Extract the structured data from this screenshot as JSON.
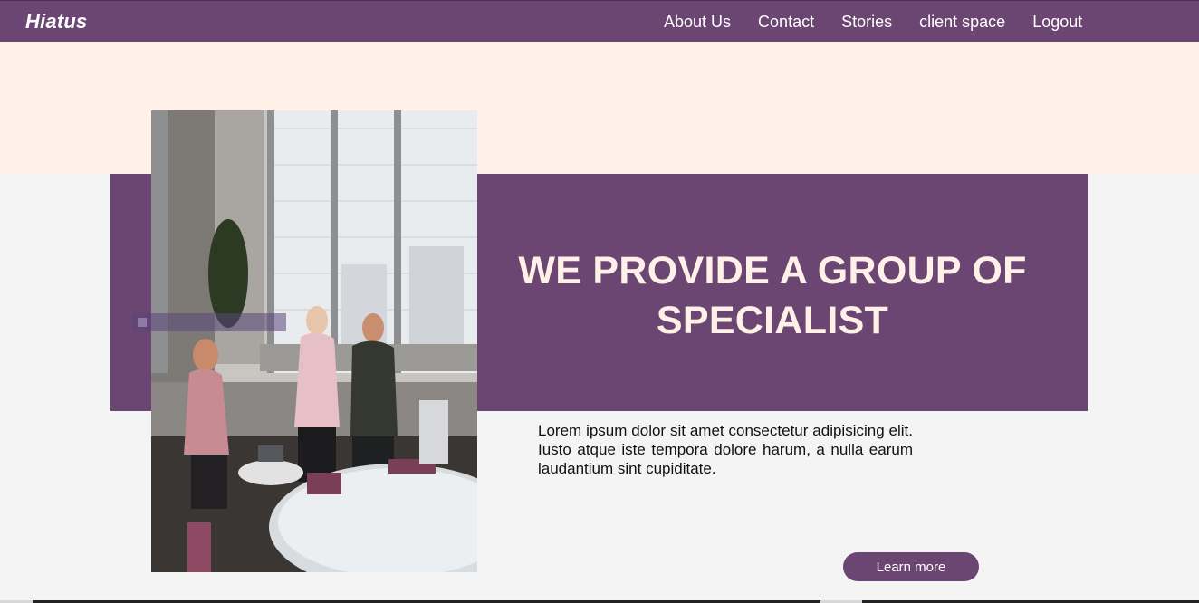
{
  "header": {
    "brand": "Hiatus",
    "nav": [
      "About Us",
      "Contact",
      "Stories",
      "client space",
      "Logout"
    ]
  },
  "hero": {
    "headline": "WE PROVIDE A GROUP OF SPECIALIST",
    "paragraph": "Lorem ipsum dolor sit amet consectetur adipisicing elit. Iusto atque iste tempora dolore harum, a nulla earum laudantium sint cupiditate.",
    "button_label": "Learn more",
    "image_icon": "photo-icon"
  },
  "colors": {
    "primary": "#6c4672",
    "peach": "#fff0e8",
    "background": "#f4f4f4"
  }
}
